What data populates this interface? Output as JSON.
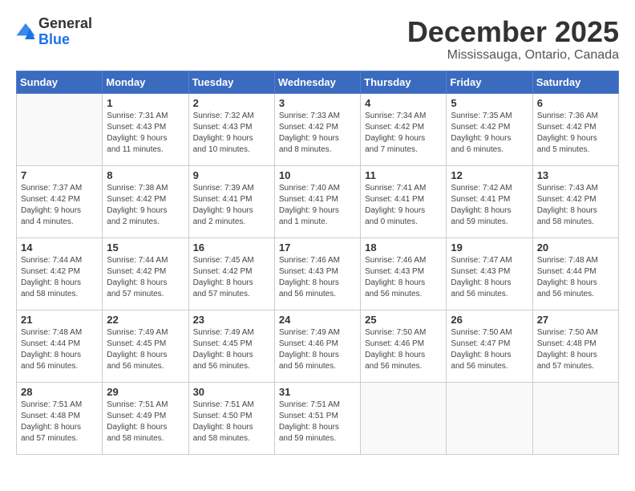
{
  "header": {
    "logo_general": "General",
    "logo_blue": "Blue",
    "title": "December 2025",
    "subtitle": "Mississauga, Ontario, Canada"
  },
  "days_of_week": [
    "Sunday",
    "Monday",
    "Tuesday",
    "Wednesday",
    "Thursday",
    "Friday",
    "Saturday"
  ],
  "weeks": [
    [
      {
        "day": "",
        "detail": ""
      },
      {
        "day": "1",
        "detail": "Sunrise: 7:31 AM\nSunset: 4:43 PM\nDaylight: 9 hours\nand 11 minutes."
      },
      {
        "day": "2",
        "detail": "Sunrise: 7:32 AM\nSunset: 4:43 PM\nDaylight: 9 hours\nand 10 minutes."
      },
      {
        "day": "3",
        "detail": "Sunrise: 7:33 AM\nSunset: 4:42 PM\nDaylight: 9 hours\nand 8 minutes."
      },
      {
        "day": "4",
        "detail": "Sunrise: 7:34 AM\nSunset: 4:42 PM\nDaylight: 9 hours\nand 7 minutes."
      },
      {
        "day": "5",
        "detail": "Sunrise: 7:35 AM\nSunset: 4:42 PM\nDaylight: 9 hours\nand 6 minutes."
      },
      {
        "day": "6",
        "detail": "Sunrise: 7:36 AM\nSunset: 4:42 PM\nDaylight: 9 hours\nand 5 minutes."
      }
    ],
    [
      {
        "day": "7",
        "detail": "Sunrise: 7:37 AM\nSunset: 4:42 PM\nDaylight: 9 hours\nand 4 minutes."
      },
      {
        "day": "8",
        "detail": "Sunrise: 7:38 AM\nSunset: 4:42 PM\nDaylight: 9 hours\nand 2 minutes."
      },
      {
        "day": "9",
        "detail": "Sunrise: 7:39 AM\nSunset: 4:41 PM\nDaylight: 9 hours\nand 2 minutes."
      },
      {
        "day": "10",
        "detail": "Sunrise: 7:40 AM\nSunset: 4:41 PM\nDaylight: 9 hours\nand 1 minute."
      },
      {
        "day": "11",
        "detail": "Sunrise: 7:41 AM\nSunset: 4:41 PM\nDaylight: 9 hours\nand 0 minutes."
      },
      {
        "day": "12",
        "detail": "Sunrise: 7:42 AM\nSunset: 4:41 PM\nDaylight: 8 hours\nand 59 minutes."
      },
      {
        "day": "13",
        "detail": "Sunrise: 7:43 AM\nSunset: 4:42 PM\nDaylight: 8 hours\nand 58 minutes."
      }
    ],
    [
      {
        "day": "14",
        "detail": "Sunrise: 7:44 AM\nSunset: 4:42 PM\nDaylight: 8 hours\nand 58 minutes."
      },
      {
        "day": "15",
        "detail": "Sunrise: 7:44 AM\nSunset: 4:42 PM\nDaylight: 8 hours\nand 57 minutes."
      },
      {
        "day": "16",
        "detail": "Sunrise: 7:45 AM\nSunset: 4:42 PM\nDaylight: 8 hours\nand 57 minutes."
      },
      {
        "day": "17",
        "detail": "Sunrise: 7:46 AM\nSunset: 4:43 PM\nDaylight: 8 hours\nand 56 minutes."
      },
      {
        "day": "18",
        "detail": "Sunrise: 7:46 AM\nSunset: 4:43 PM\nDaylight: 8 hours\nand 56 minutes."
      },
      {
        "day": "19",
        "detail": "Sunrise: 7:47 AM\nSunset: 4:43 PM\nDaylight: 8 hours\nand 56 minutes."
      },
      {
        "day": "20",
        "detail": "Sunrise: 7:48 AM\nSunset: 4:44 PM\nDaylight: 8 hours\nand 56 minutes."
      }
    ],
    [
      {
        "day": "21",
        "detail": "Sunrise: 7:48 AM\nSunset: 4:44 PM\nDaylight: 8 hours\nand 56 minutes."
      },
      {
        "day": "22",
        "detail": "Sunrise: 7:49 AM\nSunset: 4:45 PM\nDaylight: 8 hours\nand 56 minutes."
      },
      {
        "day": "23",
        "detail": "Sunrise: 7:49 AM\nSunset: 4:45 PM\nDaylight: 8 hours\nand 56 minutes."
      },
      {
        "day": "24",
        "detail": "Sunrise: 7:49 AM\nSunset: 4:46 PM\nDaylight: 8 hours\nand 56 minutes."
      },
      {
        "day": "25",
        "detail": "Sunrise: 7:50 AM\nSunset: 4:46 PM\nDaylight: 8 hours\nand 56 minutes."
      },
      {
        "day": "26",
        "detail": "Sunrise: 7:50 AM\nSunset: 4:47 PM\nDaylight: 8 hours\nand 56 minutes."
      },
      {
        "day": "27",
        "detail": "Sunrise: 7:50 AM\nSunset: 4:48 PM\nDaylight: 8 hours\nand 57 minutes."
      }
    ],
    [
      {
        "day": "28",
        "detail": "Sunrise: 7:51 AM\nSunset: 4:48 PM\nDaylight: 8 hours\nand 57 minutes."
      },
      {
        "day": "29",
        "detail": "Sunrise: 7:51 AM\nSunset: 4:49 PM\nDaylight: 8 hours\nand 58 minutes."
      },
      {
        "day": "30",
        "detail": "Sunrise: 7:51 AM\nSunset: 4:50 PM\nDaylight: 8 hours\nand 58 minutes."
      },
      {
        "day": "31",
        "detail": "Sunrise: 7:51 AM\nSunset: 4:51 PM\nDaylight: 8 hours\nand 59 minutes."
      },
      {
        "day": "",
        "detail": ""
      },
      {
        "day": "",
        "detail": ""
      },
      {
        "day": "",
        "detail": ""
      }
    ]
  ]
}
